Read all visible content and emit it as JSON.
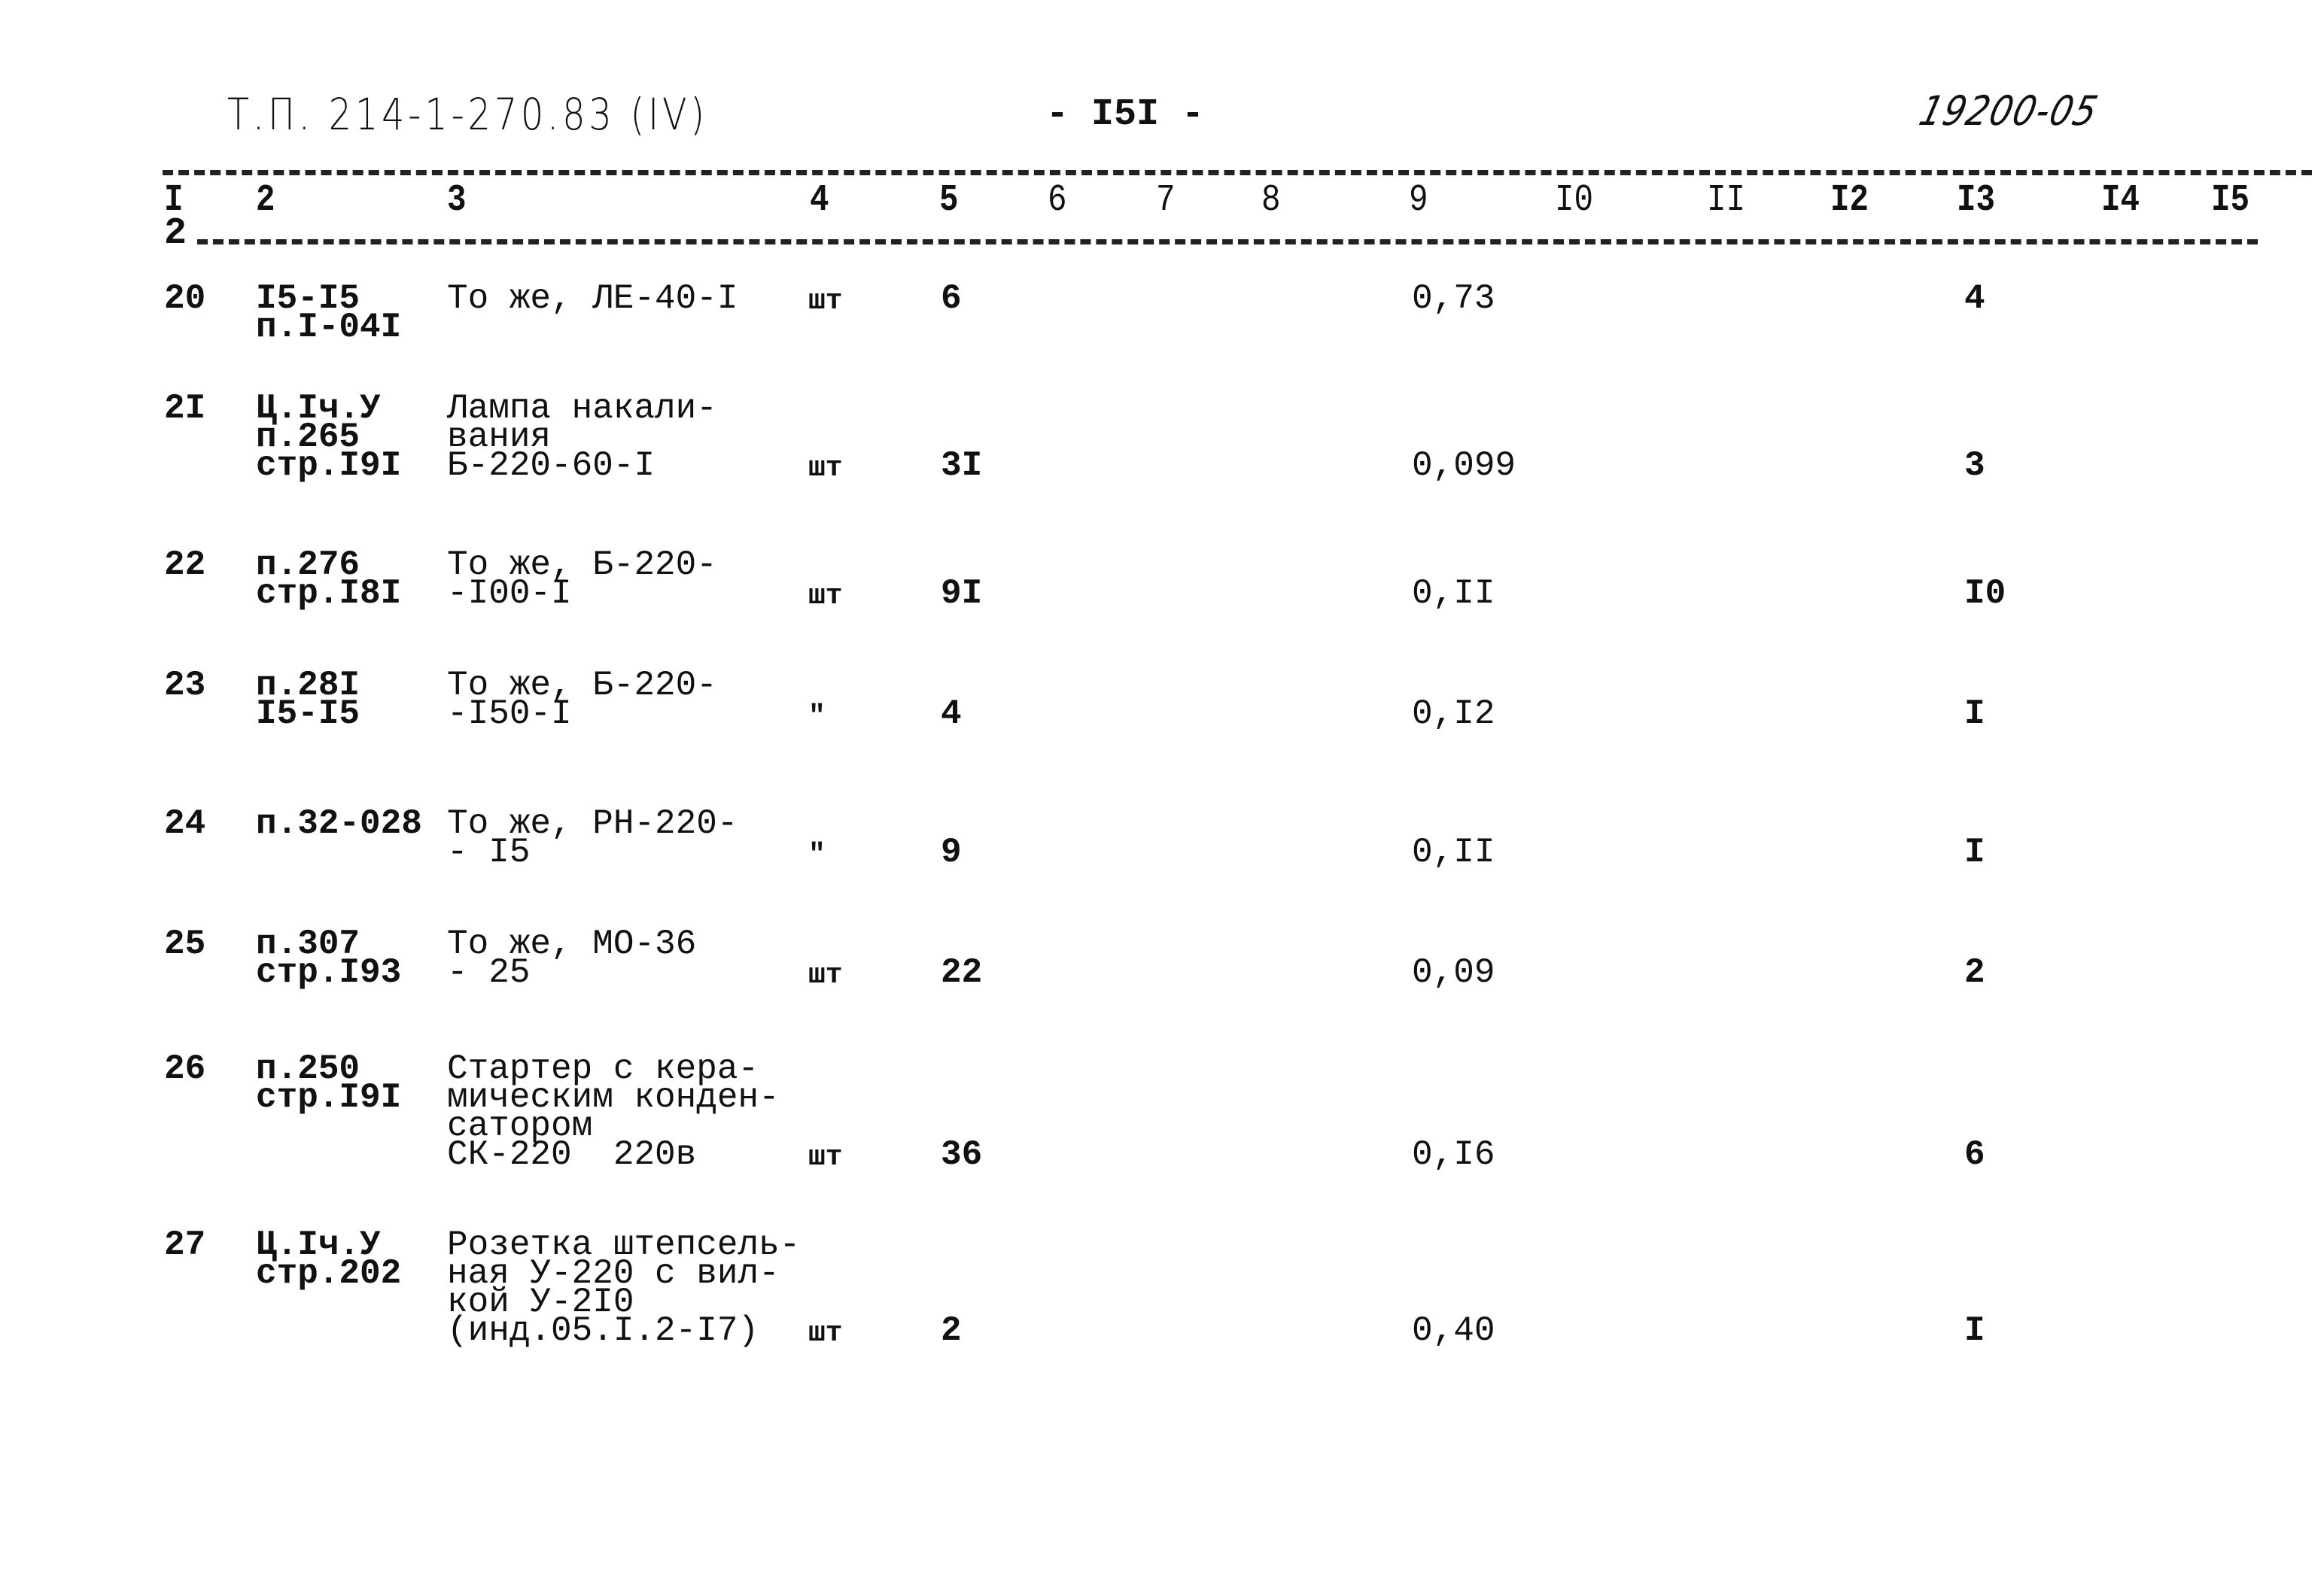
{
  "header": {
    "document_code": "Т.П. 214-1-270.83 (IV)",
    "page_number": "- I5I -",
    "archive_code": "19200-05"
  },
  "columns": [
    "I",
    "2",
    "3",
    "4",
    "5",
    "6",
    "7",
    "8",
    "9",
    "I0",
    "II",
    "I2",
    "I3",
    "I4",
    "I5"
  ],
  "column_sub": "2",
  "rows": [
    {
      "num": "20",
      "ref": [
        "I5-I5",
        "п.I-04I"
      ],
      "name": [
        "То же, ЛЕ-40-I"
      ],
      "unit": "шт",
      "qty": "6",
      "col9": "0,73",
      "col13": "4"
    },
    {
      "num": "2I",
      "ref": [
        "Ц.Iч.У",
        "п.265",
        "стр.I9I"
      ],
      "name": [
        "Лампа накали-",
        "вания",
        "Б-220-60-I"
      ],
      "unit": "шт",
      "qty": "3I",
      "col9": "0,099",
      "col13": "3"
    },
    {
      "num": "22",
      "ref": [
        "п.276",
        "стр.I8I"
      ],
      "name": [
        "То же, Б-220-",
        "-I00-I"
      ],
      "unit": "шт",
      "qty": "9I",
      "col9": "0,II",
      "col13": "I0"
    },
    {
      "num": "23",
      "ref": [
        "п.28I",
        "I5-I5"
      ],
      "name": [
        "То же, Б-220-",
        "-I50-I"
      ],
      "unit": "\"",
      "qty": "4",
      "col9": "0,I2",
      "col13": "I"
    },
    {
      "num": "24",
      "ref": [
        "п.32-028"
      ],
      "name": [
        "То же, РН-220-",
        "- I5"
      ],
      "unit": "\"",
      "qty": "9",
      "col9": "0,II",
      "col13": "I"
    },
    {
      "num": "25",
      "ref": [
        "п.307",
        "стр.I93"
      ],
      "name": [
        "То же, МО-36",
        "- 25"
      ],
      "unit": "шт",
      "qty": "22",
      "col9": "0,09",
      "col13": "2"
    },
    {
      "num": "26",
      "ref": [
        "п.250",
        "стр.I9I"
      ],
      "name": [
        "Стартер с кера-",
        "мическим конден-",
        "сатором",
        "СК-220  220в"
      ],
      "unit": "шт",
      "qty": "36",
      "col9": "0,I6",
      "col13": "6"
    },
    {
      "num": "27",
      "ref": [
        "Ц.Iч.У",
        "стр.202"
      ],
      "name": [
        "Розетка штепсель-",
        "ная У-220 с вил-",
        "кой У-2I0",
        "(инд.05.I.2-I7)"
      ],
      "unit": "шт",
      "qty": "2",
      "col9": "0,40",
      "col13": "I"
    }
  ]
}
